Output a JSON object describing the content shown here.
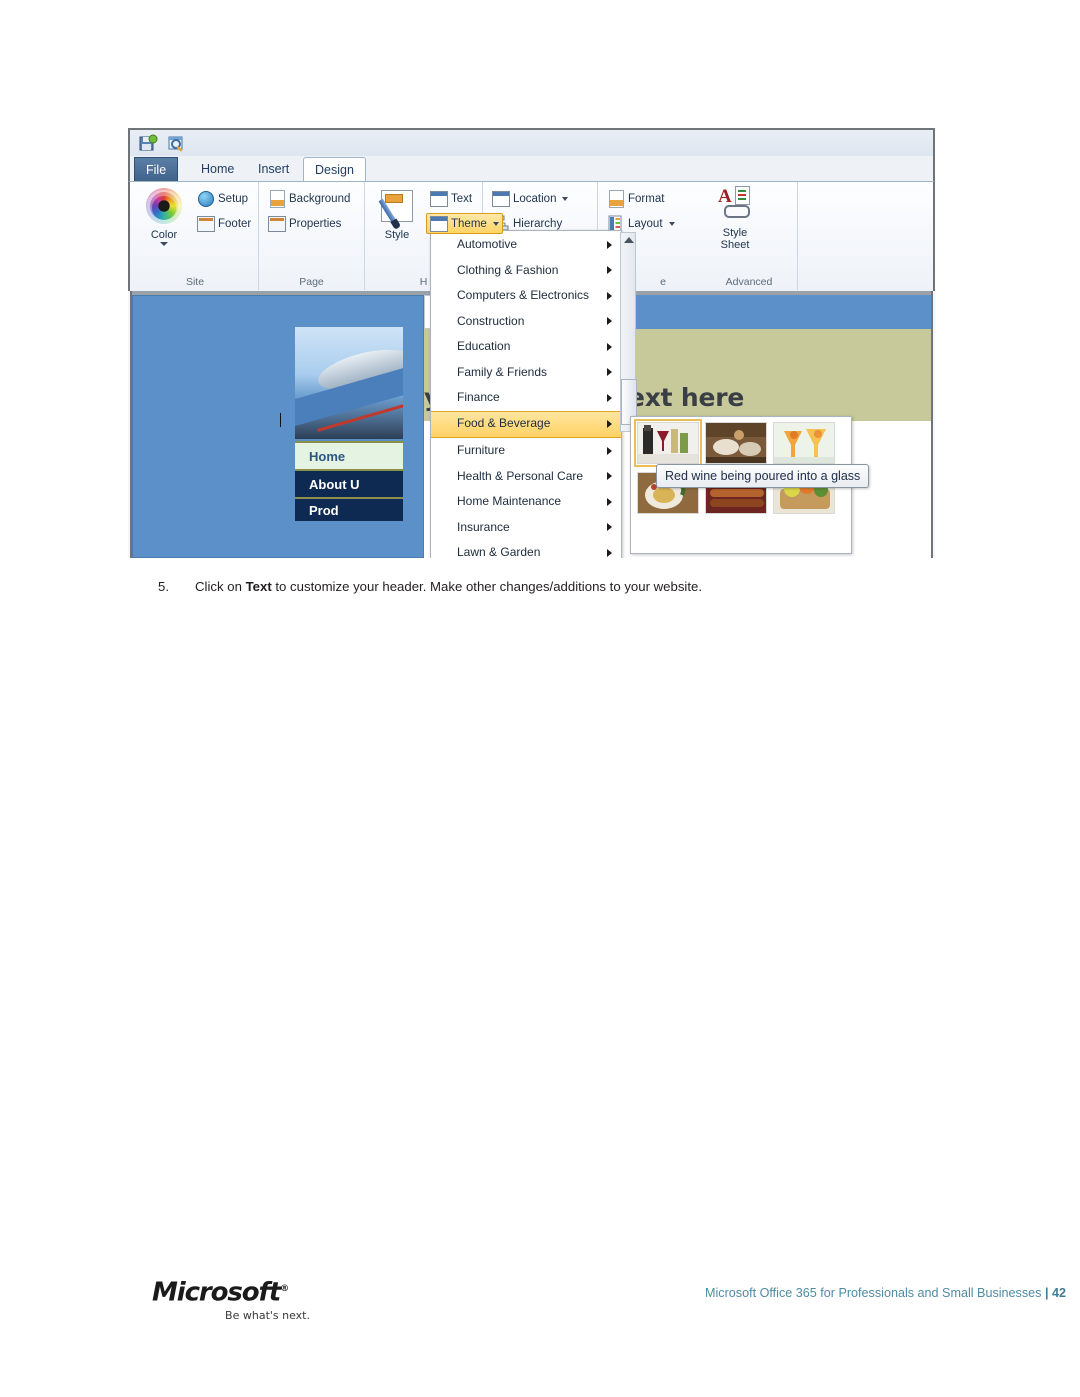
{
  "document": {
    "step": {
      "number": "5.",
      "text_before": "Click on ",
      "bold_word": "Text",
      "text_after": " to customize your header. Make other changes/additions to your website."
    },
    "footer": {
      "logo_word": "Microsoft",
      "logo_trademark": "®",
      "tagline": "Be what's next.",
      "right_text": "Microsoft Office 365 for Professionals and Small Businesses",
      "separator": "|",
      "page_number": "42"
    }
  },
  "screenshot": {
    "quick_access": [
      {
        "name": "save-icon",
        "label": "Save"
      },
      {
        "name": "preview-icon",
        "label": "Preview in Browser"
      }
    ],
    "tabs": [
      {
        "label": "File",
        "active": false
      },
      {
        "label": "Home",
        "active": false
      },
      {
        "label": "Insert",
        "active": false
      },
      {
        "label": "Design",
        "active": true
      }
    ],
    "ribbon": {
      "groups": [
        {
          "label": "Site"
        },
        {
          "label": "Page"
        },
        {
          "label": "H"
        },
        {
          "label": "e"
        },
        {
          "label": "Advanced"
        }
      ],
      "buttons": {
        "color": "Color",
        "setup": "Setup",
        "footer": "Footer",
        "background": "Background",
        "properties": "Properties",
        "style": "Style",
        "text": "Text",
        "theme": "Theme",
        "location": "Location",
        "hierarchy": "Hierarchy",
        "format": "Format",
        "layout": "Layout",
        "style_sheet_line1": "Style",
        "style_sheet_line2": "Sheet"
      }
    },
    "theme_menu": {
      "items": [
        {
          "label": "Automotive",
          "highlighted": false
        },
        {
          "label": "Clothing & Fashion",
          "highlighted": false
        },
        {
          "label": "Computers & Electronics",
          "highlighted": false
        },
        {
          "label": "Construction",
          "highlighted": false
        },
        {
          "label": "Education",
          "highlighted": false
        },
        {
          "label": "Family & Friends",
          "highlighted": false
        },
        {
          "label": "Finance",
          "highlighted": false
        },
        {
          "label": "Food & Beverage",
          "highlighted": true
        },
        {
          "label": "Furniture",
          "highlighted": false
        },
        {
          "label": "Health & Personal Care",
          "highlighted": false
        },
        {
          "label": "Home Maintenance",
          "highlighted": false
        },
        {
          "label": "Insurance",
          "highlighted": false
        },
        {
          "label": "Lawn & Garden",
          "highlighted": false
        }
      ]
    },
    "thumbnail_flyout": {
      "tooltip": "Red wine being poured into a glass",
      "thumbnails": [
        {
          "name": "thumbnail-red-wine",
          "selected": true
        },
        {
          "name": "thumbnail-restaurant-table",
          "selected": false
        },
        {
          "name": "thumbnail-cocktail-drinks",
          "selected": false
        },
        {
          "name": "thumbnail-plated-dish",
          "selected": false
        },
        {
          "name": "thumbnail-grilled-food",
          "selected": false
        },
        {
          "name": "thumbnail-vegetable-basket",
          "selected": false
        }
      ]
    },
    "website_preview": {
      "heading": "your heading text here",
      "nav": [
        {
          "label": "Home",
          "active": true
        },
        {
          "label": "About U",
          "active": false
        },
        {
          "label": "Prod",
          "active": false
        }
      ],
      "search_placeholder": ""
    },
    "colors": {
      "highlight": "#ffd264",
      "tab_file": "#3d6189",
      "preview_blue": "#5c90c8",
      "preview_olive": "#c8c99b",
      "nav_dark": "#0f2a52",
      "search_orange": "#f08a08",
      "dashed_red": "#f01c1c",
      "footer_link": "#4f8ba3"
    }
  }
}
